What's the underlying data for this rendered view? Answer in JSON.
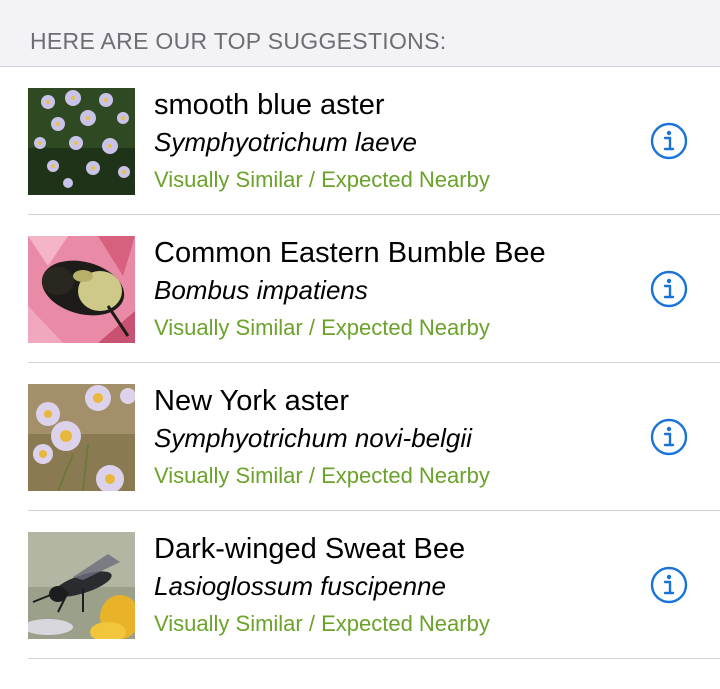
{
  "header": {
    "title": "HERE ARE OUR TOP SUGGESTIONS:"
  },
  "colors": {
    "accent": "#1a73d9",
    "reason": "#6aa22a",
    "header_bg": "#f2f2f7"
  },
  "suggestions": [
    {
      "common_name": "smooth blue aster",
      "scientific_name": "Symphyotrichum laeve",
      "reason": "Visually Similar / Expected Nearby",
      "thumbnail": "smooth-blue-aster-photo",
      "info_icon": "info-icon"
    },
    {
      "common_name": "Common Eastern Bumble Bee",
      "scientific_name": "Bombus impatiens",
      "reason": "Visually Similar / Expected Nearby",
      "thumbnail": "bumble-bee-photo",
      "info_icon": "info-icon"
    },
    {
      "common_name": "New York aster",
      "scientific_name": "Symphyotrichum novi-belgii",
      "reason": "Visually Similar / Expected Nearby",
      "thumbnail": "new-york-aster-photo",
      "info_icon": "info-icon"
    },
    {
      "common_name": "Dark-winged Sweat Bee",
      "scientific_name": "Lasioglossum fuscipenne",
      "reason": "Visually Similar / Expected Nearby",
      "thumbnail": "sweat-bee-photo",
      "info_icon": "info-icon"
    }
  ]
}
